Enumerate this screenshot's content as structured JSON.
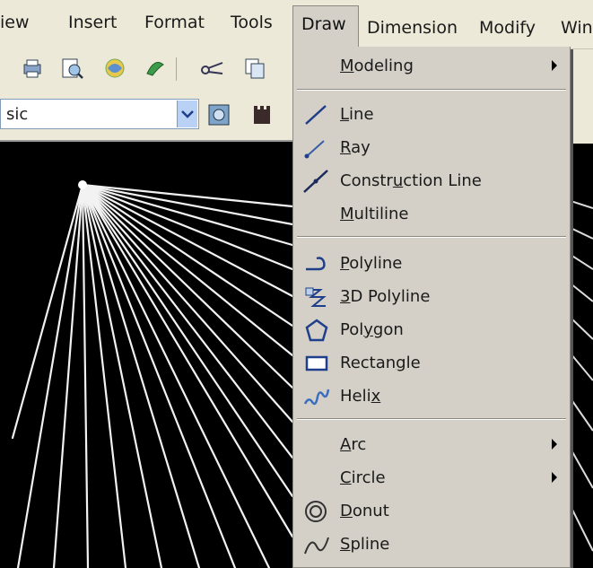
{
  "menubar": {
    "items": [
      {
        "label": "iew"
      },
      {
        "label": "Insert"
      },
      {
        "label": "Format"
      },
      {
        "label": "Tools"
      },
      {
        "label": "Draw"
      },
      {
        "label": "Dimension"
      },
      {
        "label": "Modify"
      },
      {
        "label": "Win"
      }
    ]
  },
  "toolbar": {
    "style_value": "sic"
  },
  "draw_menu": {
    "items": [
      {
        "pre": "",
        "ul": "M",
        "post": "odeling",
        "submenu": true
      },
      {
        "pre": "",
        "ul": "L",
        "post": "ine",
        "icon": "line-icon"
      },
      {
        "pre": "",
        "ul": "R",
        "post": "ay",
        "icon": "ray-icon"
      },
      {
        "pre": "Constr",
        "ul": "u",
        "post": "ction Line",
        "icon": "construction-line-icon"
      },
      {
        "pre": "",
        "ul": "M",
        "post": "ultiline"
      },
      {
        "pre": "",
        "ul": "P",
        "post": "olyline",
        "icon": "polyline-icon"
      },
      {
        "pre": "",
        "ul": "3",
        "post": "D Polyline",
        "icon": "3d-polyline-icon"
      },
      {
        "pre": "Pol",
        "ul": "y",
        "post": "gon",
        "icon": "polygon-icon"
      },
      {
        "pre": "Rectan",
        "ul": "g",
        "post": "le",
        "icon": "rectangle-icon"
      },
      {
        "pre": "Heli",
        "ul": "x",
        "post": "",
        "icon": "helix-icon"
      },
      {
        "pre": "",
        "ul": "A",
        "post": "rc",
        "submenu": true
      },
      {
        "pre": "",
        "ul": "C",
        "post": "ircle",
        "submenu": true
      },
      {
        "pre": "",
        "ul": "D",
        "post": "onut",
        "icon": "donut-icon"
      },
      {
        "pre": "",
        "ul": "S",
        "post": "pline",
        "icon": "spline-icon"
      }
    ]
  }
}
